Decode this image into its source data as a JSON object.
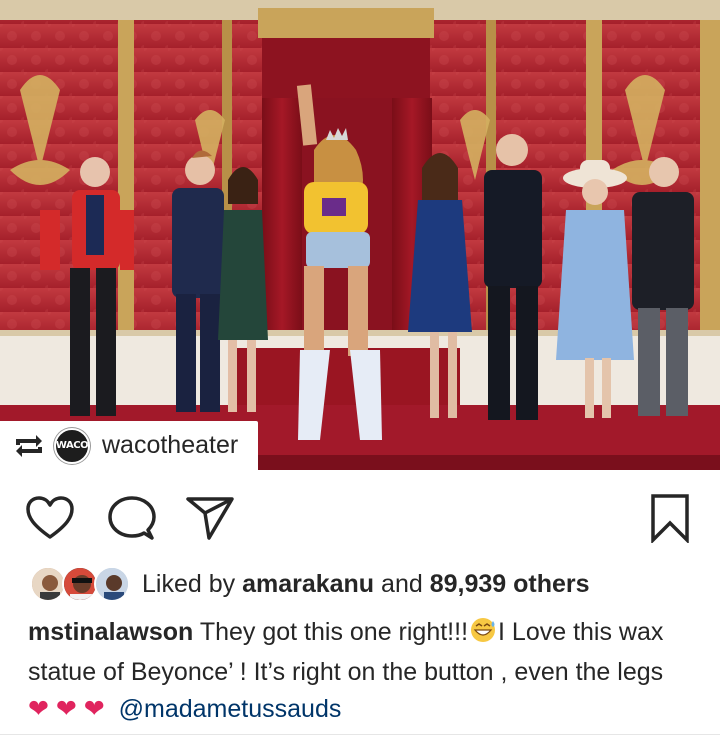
{
  "post": {
    "repost_user": "wacotheater",
    "repost_avatar_text": "WACO",
    "photo_icon": "wax-museum-photo"
  },
  "actions": {
    "like_icon": "heart-outline-icon",
    "comment_icon": "comment-bubble-icon",
    "share_icon": "paper-plane-icon",
    "save_icon": "bookmark-icon"
  },
  "likes": {
    "prefix": "Liked by ",
    "user": "amarakanu",
    "middle": " and ",
    "count": "89,939 others"
  },
  "caption": {
    "author": "mstinalawson",
    "text_1": " They got this one right!!!",
    "text_2": "I Love this wax statue of Beyonce’ ! It’s right on  the button , even the legs ",
    "hearts": "❤ ❤ ❤",
    "mention": "@madametussauds"
  },
  "colors": {
    "wall_red": "#b92a33",
    "gold": "#c9a45a",
    "heart": "#e0245e"
  }
}
